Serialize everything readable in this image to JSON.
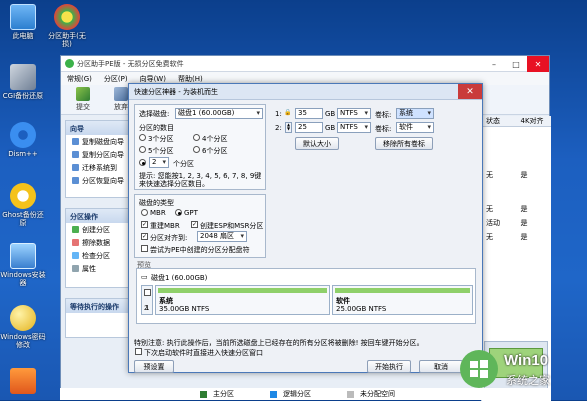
{
  "desktop": {
    "icons": [
      {
        "label": "此电脑"
      },
      {
        "label": "分区助手(无损)"
      },
      {
        "label": "CGI备份还原"
      },
      {
        "label": "Dism++"
      },
      {
        "label": "Ghost备份还原"
      },
      {
        "label": "Windows安装器"
      },
      {
        "label": "Windows密码修改"
      },
      {
        "label": ""
      }
    ]
  },
  "main_window": {
    "title": "分区助手PE版 - 无损分区免费软件",
    "menu": [
      "常规(G)",
      "分区(P)",
      "向导(W)",
      "帮助(H)"
    ],
    "toolbar": [
      "提交",
      "放弃"
    ],
    "wizard_header": "向导",
    "wizard_items": [
      "复制磁盘向导",
      "复制分区向导",
      "迁移系统到",
      "分区恢复向导"
    ],
    "ops_header": "分区操作",
    "ops_items": [
      "创建分区",
      "擦除数据",
      "检查分区",
      "属性"
    ],
    "pending_header": "等待执行的操作",
    "col_status": "状态",
    "col_4k": "4K对齐",
    "rows": [
      {
        "status": "无",
        "align": "是"
      },
      {
        "status": "无",
        "align": "是"
      },
      {
        "status": "活动",
        "align": "是"
      },
      {
        "status": "无",
        "align": "是"
      }
    ],
    "legend": [
      "主分区",
      "逻辑分区",
      "未分配空间"
    ]
  },
  "dialog": {
    "title": "快速分区神器 - 为装机而生",
    "select_disk_label": "选择磁盘:",
    "select_disk_value": "磁盘1 (60.00GB)",
    "count_label": "分区的数目",
    "opt3": "3个分区",
    "opt4": "4个分区",
    "opt5": "5个分区",
    "opt6": "6个分区",
    "custom_count": "2",
    "custom_unit": "个分区",
    "tip": "提示: 您能按1, 2, 3, 4, 5, 6, 7, 8, 9键来快速选择分区数目。",
    "disk_type_label": "磁盘的类型",
    "mbr": "MBR",
    "gpt": "GPT",
    "rebuild_mbr": "重建MBR",
    "create_esp": "创建ESP和MSR分区",
    "align_label": "分区对齐到:",
    "align_value": "2048 扇区",
    "try_restore": "尝试为PE中创建的分区分配盘符",
    "partitions": [
      {
        "idx": "1:",
        "size": "35",
        "unit": "GB",
        "fs": "NTFS",
        "vol_label": "卷标:",
        "vol": "系统"
      },
      {
        "idx": "2:",
        "size": "25",
        "unit": "GB",
        "fs": "NTFS",
        "vol_label": "卷标:",
        "vol": "软件"
      }
    ],
    "default_size_btn": "默认大小",
    "clear_labels_btn": "移除所有卷标",
    "preview_label": "预览",
    "preview_disk": "磁盘1 (60.00GB)",
    "preview_parts": [
      {
        "num": "1",
        "name": "系统",
        "info": "35.00GB NTFS"
      },
      {
        "num": "2",
        "name": "软件",
        "info": "25.00GB NTFS"
      }
    ],
    "warning": "特别注意: 执行此操作后，当前所选磁盘上已经存在的所有分区将被删除! 按回车键开始分区。",
    "next_start": "下次启动软件时直接进入快速分区窗口",
    "presets_btn": "预设置",
    "start_btn": "开始执行",
    "cancel_btn": "取消"
  },
  "watermark": {
    "brand": "Win10",
    "site": "系统之家"
  },
  "colors": {
    "desktop": "#1c5fc0",
    "accent": "#2b6cd6",
    "bar_green": "#8fd06a",
    "watermark_green": "#5fb65a"
  }
}
